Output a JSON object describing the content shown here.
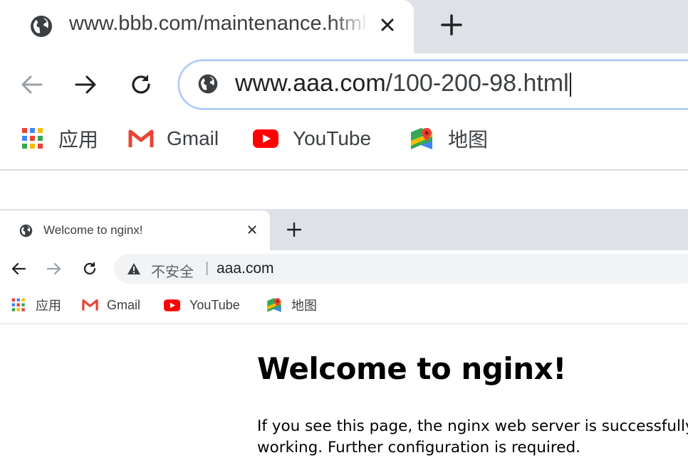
{
  "window1": {
    "tab": {
      "title": "www.bbb.com/maintenance.html",
      "close_icon": "close-icon",
      "favicon": "globe-icon"
    },
    "new_tab_icon": "plus-icon",
    "nav": {
      "back_icon": "arrow-left-icon",
      "forward_icon": "arrow-right-icon",
      "reload_icon": "reload-icon"
    },
    "omnibox": {
      "host": "www.aaa.com",
      "path": "/100-200-98.html",
      "site_icon": "globe-icon"
    },
    "bookmarks": [
      {
        "label": "应用",
        "icon": "apps-grid-icon"
      },
      {
        "label": "Gmail",
        "icon": "gmail-icon"
      },
      {
        "label": "YouTube",
        "icon": "youtube-icon"
      },
      {
        "label": "地图",
        "icon": "maps-icon"
      }
    ]
  },
  "window2": {
    "tab": {
      "title": "Welcome to nginx!",
      "close_icon": "close-icon",
      "favicon": "globe-icon"
    },
    "new_tab_icon": "plus-icon",
    "nav": {
      "back_icon": "arrow-left-icon",
      "forward_icon": "arrow-right-icon",
      "reload_icon": "reload-icon"
    },
    "omnibox": {
      "security_label": "不安全",
      "separator": "|",
      "url": "aaa.com",
      "site_icon": "warning-icon"
    },
    "bookmarks": [
      {
        "label": "应用",
        "icon": "apps-grid-icon"
      },
      {
        "label": "Gmail",
        "icon": "gmail-icon"
      },
      {
        "label": "YouTube",
        "icon": "youtube-icon"
      },
      {
        "label": "地图",
        "icon": "maps-icon"
      }
    ]
  },
  "page": {
    "heading": "Welcome to nginx!",
    "paragraph_lines": [
      "If you see this page, the nginx web server is successfully installed and",
      "working. Further configuration is required."
    ]
  },
  "colors": {
    "tabstrip": "#dee1e6",
    "focus_ring": "#a8c7fa",
    "omnibox_bg": "#f1f3f4",
    "gmail_red": "#ea4335",
    "youtube_red": "#ff0000"
  }
}
